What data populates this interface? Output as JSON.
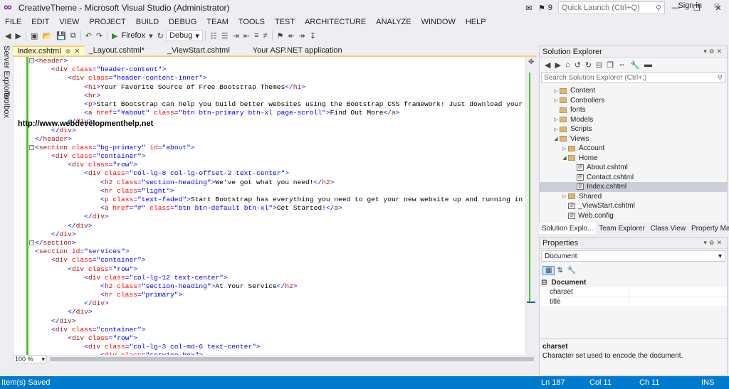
{
  "window": {
    "title": "CreativeTheme - Microsoft Visual Studio (Administrator)",
    "notifications": "9",
    "quick_launch_placeholder": "Quick Launch (Ctrl+Q)"
  },
  "menu": [
    "FILE",
    "EDIT",
    "VIEW",
    "PROJECT",
    "BUILD",
    "DEBUG",
    "TEAM",
    "TOOLS",
    "TEST",
    "ARCHITECTURE",
    "ANALYZE",
    "WINDOW",
    "HELP"
  ],
  "sign_in": "Sign in",
  "toolbar": {
    "browser": "Firefox",
    "config": "Debug"
  },
  "left_tabs": [
    "Server Explorer",
    "Toolbox"
  ],
  "doc_tabs": [
    {
      "label": "Index.cshtml",
      "active": true
    },
    {
      "label": "_Layout.cshtml*",
      "active": false
    },
    {
      "label": "_ViewStart.cshtml",
      "active": false
    },
    {
      "label": "Your ASP.NET application",
      "active": false
    }
  ],
  "watermark": "http://www.webdevelopmenthelp.net",
  "code_lines": [
    {
      "indent": 0,
      "html": "<span class='br'>&lt;</span><span class='tag'>header</span><span class='br'>&gt;</span>"
    },
    {
      "indent": 4,
      "html": "<span class='br'>&lt;</span><span class='tag'>div</span> <span class='attr'>class</span><span class='br'>=</span><span class='val'>\"header-content\"</span><span class='br'>&gt;</span>"
    },
    {
      "indent": 8,
      "html": "<span class='br'>&lt;</span><span class='tag'>div</span> <span class='attr'>class</span><span class='br'>=</span><span class='val'>\"header-content-inner\"</span><span class='br'>&gt;</span>"
    },
    {
      "indent": 12,
      "html": "<span class='br'>&lt;</span><span class='tag'>h1</span><span class='br'>&gt;</span>Your Favorite Source of Free Bootstrap Themes<span class='br'>&lt;/</span><span class='tag'>h1</span><span class='br'>&gt;</span>"
    },
    {
      "indent": 12,
      "html": "<span class='br'>&lt;</span><span class='tag'>hr</span><span class='br'>&gt;</span>"
    },
    {
      "indent": 12,
      "html": "<span class='br'>&lt;</span><span class='tag'>p</span><span class='br'>&gt;</span>Start Bootstrap can help you build better websites using the Bootstrap CSS framework! Just download your template an"
    },
    {
      "indent": 12,
      "html": "<span class='br'>&lt;</span><span class='tag'>a</span> <span class='attr'>href</span><span class='br'>=</span><span class='val'>\"#about\"</span> <span class='attr'>class</span><span class='br'>=</span><span class='val'>\"btn btn-primary btn-xl page-scroll\"</span><span class='br'>&gt;</span>Find Out More<span class='br'>&lt;/</span><span class='tag'>a</span><span class='br'>&gt;</span>"
    },
    {
      "indent": 8,
      "html": "<span class='br'>&lt;/</span><span class='tag'>div</span><span class='br'>&gt;</span>"
    },
    {
      "indent": 4,
      "html": "<span class='br'>&lt;/</span><span class='tag'>div</span><span class='br'>&gt;</span>"
    },
    {
      "indent": 0,
      "html": "<span class='br'>&lt;/</span><span class='tag'>header</span><span class='br'>&gt;</span>"
    },
    {
      "indent": 0,
      "html": "<span class='br'>&lt;</span><span class='tag'>section</span> <span class='attr'>class</span><span class='br'>=</span><span class='val'>\"bg-primary\"</span> <span class='attr'>id</span><span class='br'>=</span><span class='val'>\"about\"</span><span class='br'>&gt;</span>"
    },
    {
      "indent": 4,
      "html": "<span class='br'>&lt;</span><span class='tag'>div</span> <span class='attr'>class</span><span class='br'>=</span><span class='val'>\"container\"</span><span class='br'>&gt;</span>"
    },
    {
      "indent": 8,
      "html": "<span class='br'>&lt;</span><span class='tag'>div</span> <span class='attr'>class</span><span class='br'>=</span><span class='val'>\"row\"</span><span class='br'>&gt;</span>"
    },
    {
      "indent": 12,
      "html": "<span class='br'>&lt;</span><span class='tag'>div</span> <span class='attr'>class</span><span class='br'>=</span><span class='val'>\"col-lg-8 col-lg-offset-2 text-center\"</span><span class='br'>&gt;</span>"
    },
    {
      "indent": 16,
      "html": "<span class='br'>&lt;</span><span class='tag'>h2</span> <span class='attr'>class</span><span class='br'>=</span><span class='val'>\"section-heading\"</span><span class='br'>&gt;</span>We've got what you need!<span class='br'>&lt;/</span><span class='tag'>h2</span><span class='br'>&gt;</span>"
    },
    {
      "indent": 16,
      "html": "<span class='br'>&lt;</span><span class='tag'>hr</span> <span class='attr'>class</span><span class='br'>=</span><span class='val'>\"light\"</span><span class='br'>&gt;</span>"
    },
    {
      "indent": 16,
      "html": "<span class='br'>&lt;</span><span class='tag'>p</span> <span class='attr'>class</span><span class='br'>=</span><span class='val'>\"text-faded\"</span><span class='br'>&gt;</span>Start Bootstrap has everything you need to get your new website up and running in no time! Al"
    },
    {
      "indent": 16,
      "html": "<span class='br'>&lt;</span><span class='tag'>a</span> <span class='attr'>href</span><span class='br'>=</span><span class='val'>\"#\"</span> <span class='attr'>class</span><span class='br'>=</span><span class='val'>\"btn btn-default btn-xl\"</span><span class='br'>&gt;</span>Get Started!<span class='br'>&lt;/</span><span class='tag'>a</span><span class='br'>&gt;</span>"
    },
    {
      "indent": 12,
      "html": "<span class='br'>&lt;/</span><span class='tag'>div</span><span class='br'>&gt;</span>"
    },
    {
      "indent": 8,
      "html": "<span class='br'>&lt;/</span><span class='tag'>div</span><span class='br'>&gt;</span>"
    },
    {
      "indent": 4,
      "html": "<span class='br'>&lt;/</span><span class='tag'>div</span><span class='br'>&gt;</span>"
    },
    {
      "indent": 0,
      "html": "<span class='br'>&lt;/</span><span class='tag'>section</span><span class='br'>&gt;</span>"
    },
    {
      "indent": 0,
      "html": "<span class='br'>&lt;</span><span class='tag'>section</span> <span class='attr'>id</span><span class='br'>=</span><span class='val'>\"services\"</span><span class='br'>&gt;</span>"
    },
    {
      "indent": 4,
      "html": "<span class='br'>&lt;</span><span class='tag'>div</span> <span class='attr'>class</span><span class='br'>=</span><span class='val'>\"container\"</span><span class='br'>&gt;</span>"
    },
    {
      "indent": 8,
      "html": "<span class='br'>&lt;</span><span class='tag'>div</span> <span class='attr'>class</span><span class='br'>=</span><span class='val'>\"row\"</span><span class='br'>&gt;</span>"
    },
    {
      "indent": 12,
      "html": "<span class='br'>&lt;</span><span class='tag'>div</span> <span class='attr'>class</span><span class='br'>=</span><span class='val'>\"col-lg-12 text-center\"</span><span class='br'>&gt;</span>"
    },
    {
      "indent": 16,
      "html": "<span class='br'>&lt;</span><span class='tag'>h2</span> <span class='attr'>class</span><span class='br'>=</span><span class='val'>\"section-heading\"</span><span class='br'>&gt;</span>At Your Service<span class='br'>&lt;/</span><span class='tag'>h2</span><span class='br'>&gt;</span>"
    },
    {
      "indent": 16,
      "html": "<span class='br'>&lt;</span><span class='tag'>hr</span> <span class='attr'>class</span><span class='br'>=</span><span class='val'>\"primary\"</span><span class='br'>&gt;</span>"
    },
    {
      "indent": 12,
      "html": "<span class='br'>&lt;/</span><span class='tag'>div</span><span class='br'>&gt;</span>"
    },
    {
      "indent": 8,
      "html": "<span class='br'>&lt;/</span><span class='tag'>div</span><span class='br'>&gt;</span>"
    },
    {
      "indent": 4,
      "html": "<span class='br'>&lt;/</span><span class='tag'>div</span><span class='br'>&gt;</span>"
    },
    {
      "indent": 4,
      "html": "<span class='br'>&lt;</span><span class='tag'>div</span> <span class='attr'>class</span><span class='br'>=</span><span class='val'>\"container\"</span><span class='br'>&gt;</span>"
    },
    {
      "indent": 8,
      "html": "<span class='br'>&lt;</span><span class='tag'>div</span> <span class='attr'>class</span><span class='br'>=</span><span class='val'>\"row\"</span><span class='br'>&gt;</span>"
    },
    {
      "indent": 12,
      "html": "<span class='br'>&lt;</span><span class='tag'>div</span> <span class='attr'>class</span><span class='br'>=</span><span class='val'>\"col-lg-3 col-md-6 text-center\"</span><span class='br'>&gt;</span>"
    },
    {
      "indent": 16,
      "html": "<span class='br'>&lt;</span><span class='tag'>div</span> <span class='attr'>class</span><span class='br'>=</span><span class='val'>\"service-box\"</span><span class='br'>&gt;</span>"
    }
  ],
  "zoom": "100 %",
  "solution_explorer": {
    "title": "Solution Explorer",
    "search_placeholder": "Search Solution Explorer (Ctrl+;)",
    "items": [
      {
        "label": "Content",
        "type": "folder",
        "level": 1,
        "expander": "collapsed"
      },
      {
        "label": "Controllers",
        "type": "folder",
        "level": 1,
        "expander": "collapsed"
      },
      {
        "label": "fonts",
        "type": "folder",
        "level": 1,
        "expander": "none"
      },
      {
        "label": "Models",
        "type": "folder",
        "level": 1,
        "expander": "collapsed"
      },
      {
        "label": "Scripts",
        "type": "folder",
        "level": 1,
        "expander": "collapsed"
      },
      {
        "label": "Views",
        "type": "folder",
        "level": 1,
        "expander": "expanded"
      },
      {
        "label": "Account",
        "type": "folder",
        "level": 2,
        "expander": "collapsed"
      },
      {
        "label": "Home",
        "type": "folder",
        "level": 2,
        "expander": "expanded"
      },
      {
        "label": "About.cshtml",
        "type": "file",
        "level": 3,
        "expander": "none"
      },
      {
        "label": "Contact.cshtml",
        "type": "file",
        "level": 3,
        "expander": "none"
      },
      {
        "label": "Index.cshtml",
        "type": "file",
        "level": 3,
        "expander": "none",
        "selected": true
      },
      {
        "label": "Shared",
        "type": "folder",
        "level": 2,
        "expander": "collapsed"
      },
      {
        "label": "_ViewStart.cshtml",
        "type": "file",
        "level": 2,
        "expander": "none"
      },
      {
        "label": "Web.config",
        "type": "file",
        "level": 2,
        "expander": "none"
      }
    ],
    "tabs": [
      "Solution Explo...",
      "Team Explorer",
      "Class View",
      "Property Mana..."
    ]
  },
  "properties": {
    "title": "Properties",
    "object": "Document",
    "category": "Document",
    "rows": [
      {
        "name": "charset",
        "value": ""
      },
      {
        "name": "title",
        "value": ""
      }
    ],
    "desc_title": "charset",
    "desc_text": "Character set used to encode the document."
  },
  "statusbar": {
    "message": "Item(s) Saved",
    "ln": "Ln 187",
    "col": "Col 11",
    "ch": "Ch 11",
    "mode": "INS"
  },
  "colors": {
    "accent": "#007acc",
    "vs_logo": "#68217a",
    "active_tab": "#fefcc8",
    "change_bar": "#4fc22d"
  }
}
